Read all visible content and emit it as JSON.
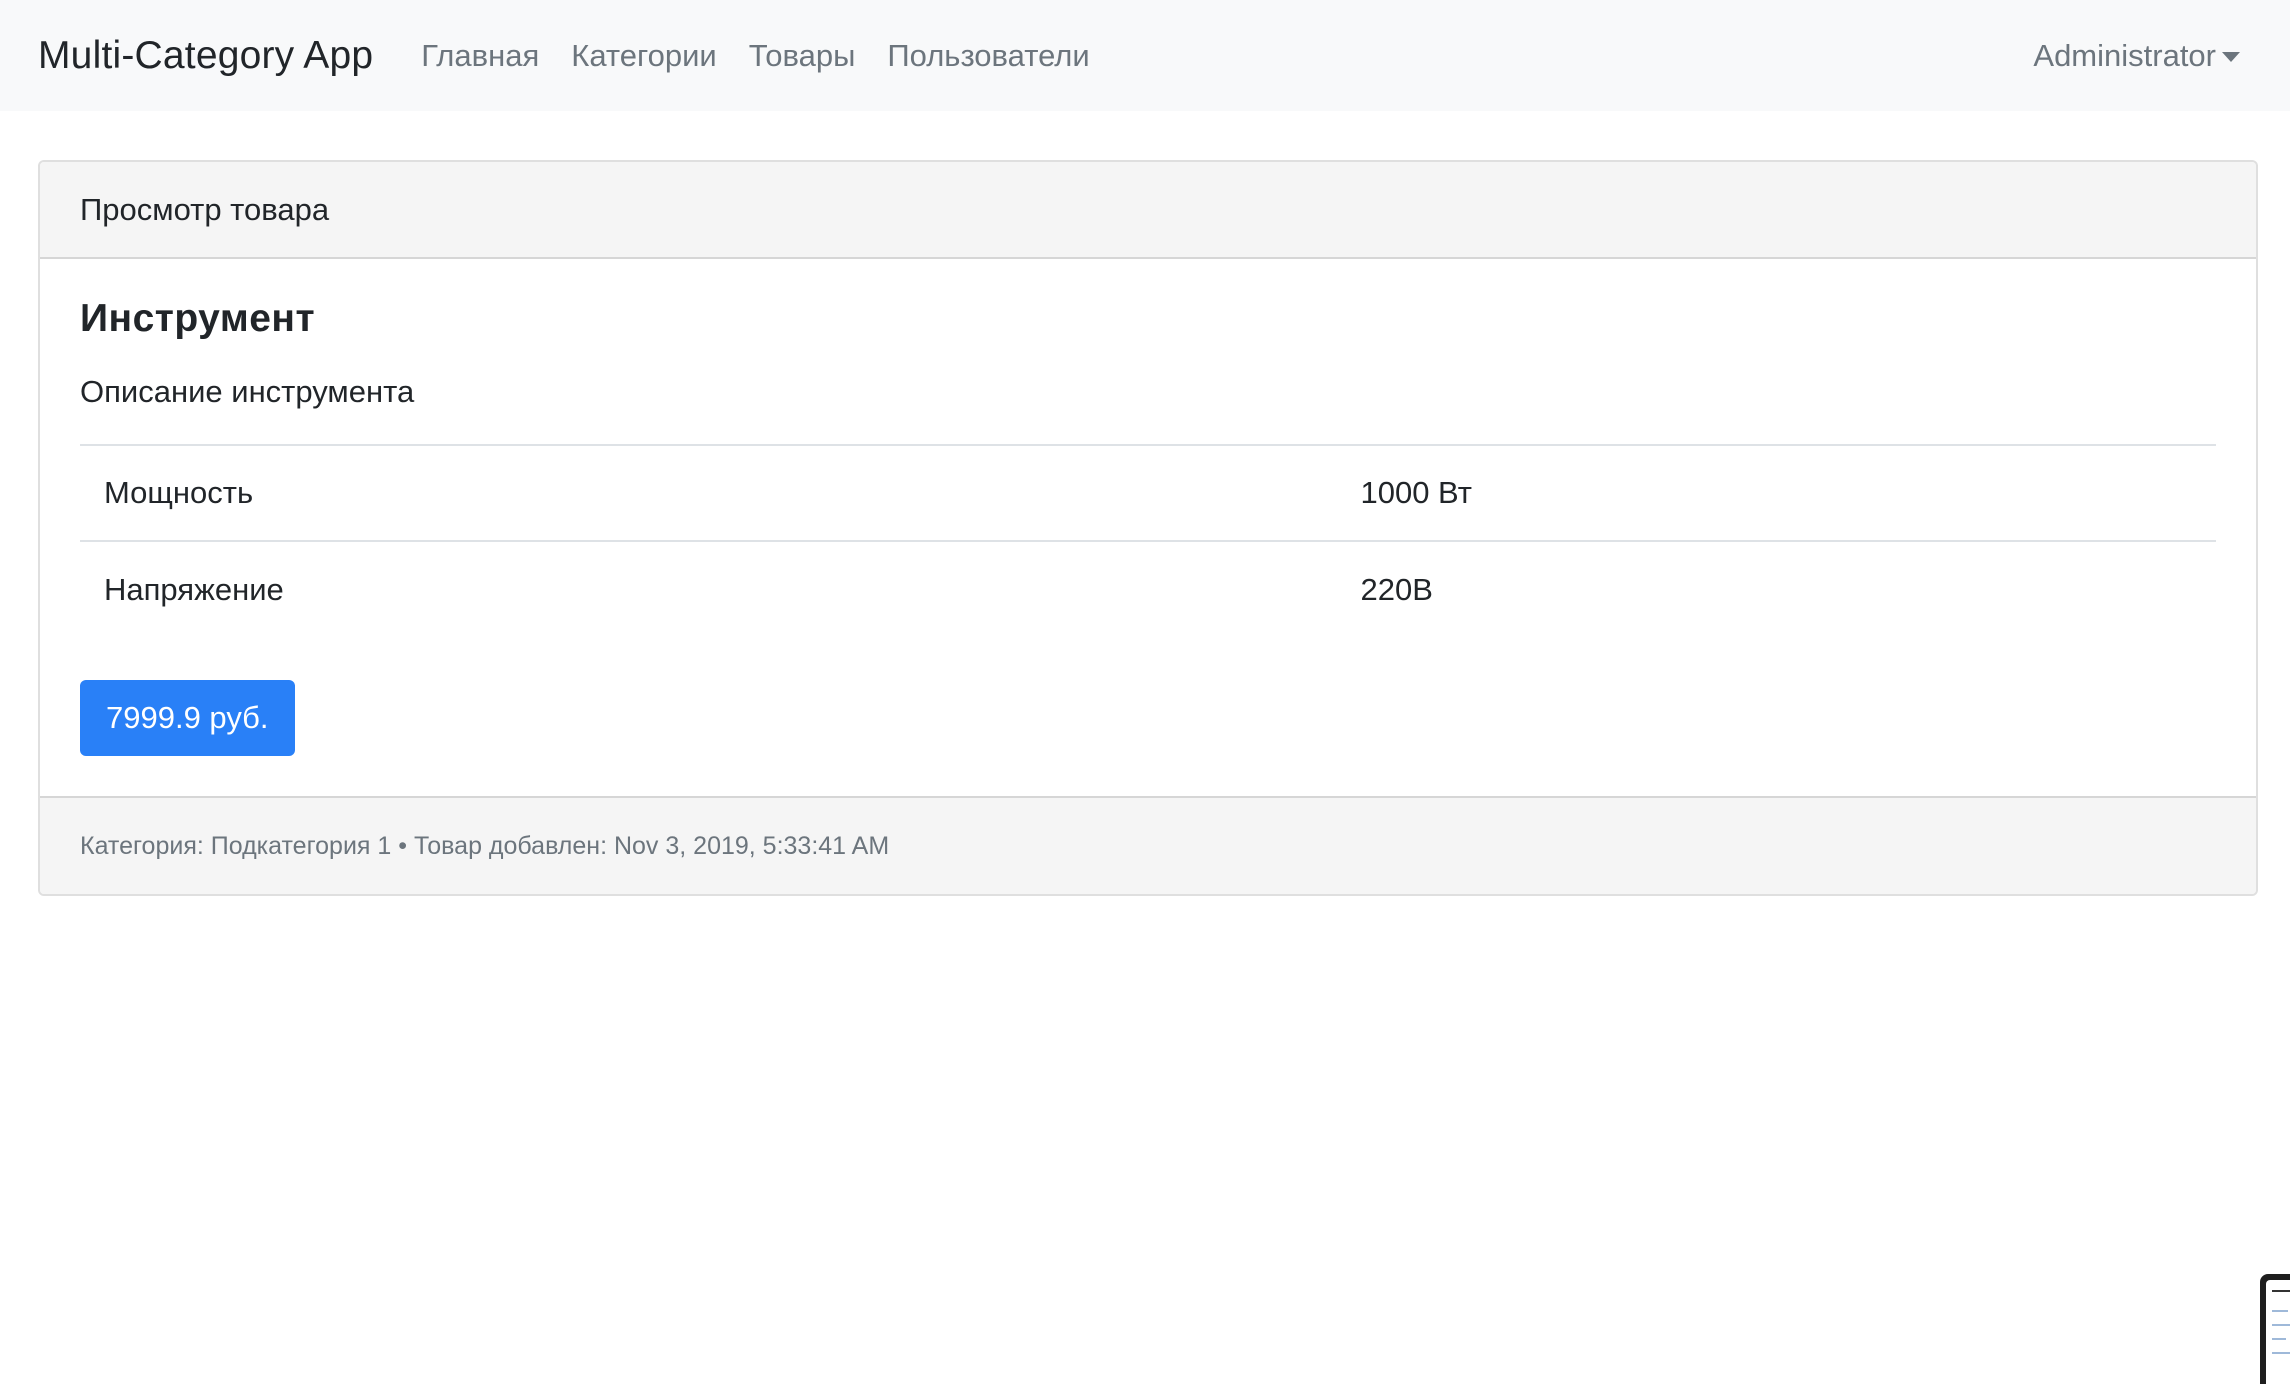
{
  "navbar": {
    "brand": "Multi-Category App",
    "links": [
      "Главная",
      "Категории",
      "Товары",
      "Пользователи"
    ],
    "user": "Administrator"
  },
  "card": {
    "header": "Просмотр товара",
    "title": "Инструмент",
    "description": "Описание инструмента",
    "specs": [
      {
        "name": "Мощность",
        "value": "1000 Вт"
      },
      {
        "name": "Напряжение",
        "value": "220В"
      }
    ],
    "price": "7999.9 руб.",
    "footer": "Категория: Подкатегория 1 • Товар добавлен: Nov 3, 2019, 5:33:41 AM"
  },
  "colors": {
    "navbar_bg": "#f8f9fa",
    "price_button": "#2980f7",
    "muted_text": "#6c757d"
  }
}
